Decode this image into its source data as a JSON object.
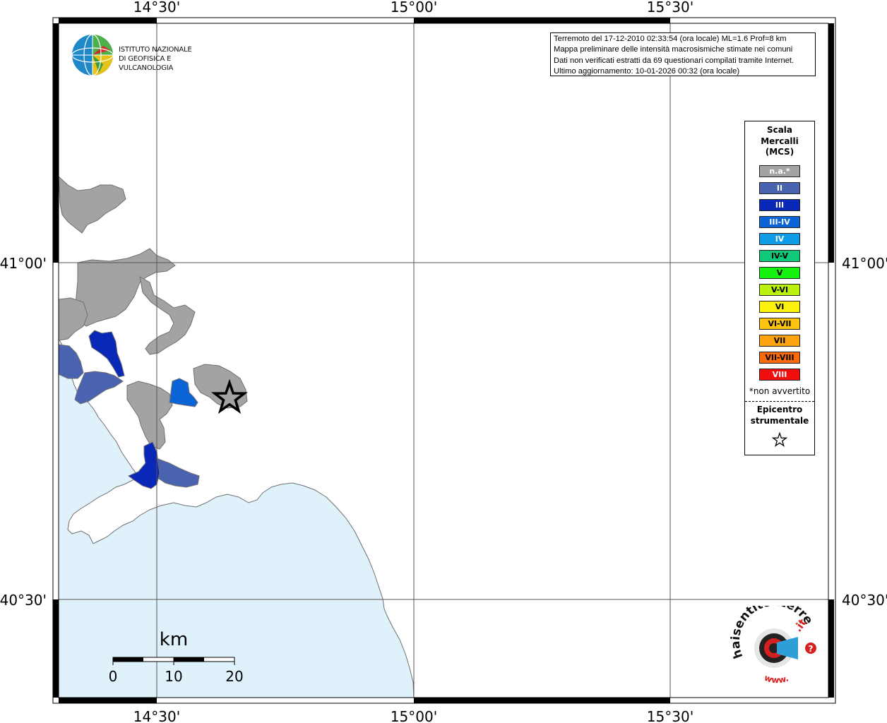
{
  "map": {
    "lon_labels": [
      "14°30'",
      "15°00'",
      "15°30'"
    ],
    "lat_labels": [
      "41°00'",
      "40°30'"
    ],
    "colors": {
      "sea": "#dff1fb",
      "coast": "#6f6f6f",
      "grid": "#555555",
      "frame": "#000000"
    }
  },
  "info": {
    "line1": "Terremoto del 17-12-2010 02:33:54 (ora locale) ML=1.6 Prof=8 km",
    "line2": "Mappa preliminare delle intensità macrosismiche stimate nei comuni",
    "line3": "Dati non verificati estratti da 69 questionari compilati tramite Internet.",
    "line4": "Ultimo aggiornamento: 10-01-2026 00:32 (ora locale)"
  },
  "logo": {
    "line1": "ISTITUTO NAZIONALE",
    "line2": "DI GEOFISICA E VULCANOLOGIA"
  },
  "legend": {
    "title1": "Scala",
    "title2": "Mercalli",
    "title3": "(MCS)",
    "items": [
      {
        "label": "n.a.*",
        "color": "#a3a3a3",
        "text_color": "#ffffff"
      },
      {
        "label": "II",
        "color": "#4a63b0",
        "text_color": "#ffffff"
      },
      {
        "label": "III",
        "color": "#0a28b8",
        "text_color": "#ffffff"
      },
      {
        "label": "III-IV",
        "color": "#0a64d6",
        "text_color": "#ffffff"
      },
      {
        "label": "IV",
        "color": "#0e9ce6",
        "text_color": "#ffffff"
      },
      {
        "label": "IV-V",
        "color": "#10c87a",
        "text_color": "#000000"
      },
      {
        "label": "V",
        "color": "#14f20e",
        "text_color": "#000000"
      },
      {
        "label": "V-VI",
        "color": "#b8f20e",
        "text_color": "#000000"
      },
      {
        "label": "VI",
        "color": "#fcf20e",
        "text_color": "#000000"
      },
      {
        "label": "VI-VII",
        "color": "#fcc40e",
        "text_color": "#000000"
      },
      {
        "label": "VII",
        "color": "#fca30e",
        "text_color": "#000000"
      },
      {
        "label": "VII-VIII",
        "color": "#fc6a0e",
        "text_color": "#000000"
      },
      {
        "label": "VIII",
        "color": "#f20e0e",
        "text_color": "#ffffff"
      }
    ],
    "note": "*non avvertito",
    "epicenter1": "Epicentro",
    "epicenter2": "strumentale"
  },
  "scale": {
    "unit": "km",
    "ticks": [
      "0",
      "10",
      "20"
    ]
  },
  "brand": {
    "main": "haisentitoilterremoto",
    "tld": ".it",
    "www": "www.",
    "qmark": "?"
  }
}
